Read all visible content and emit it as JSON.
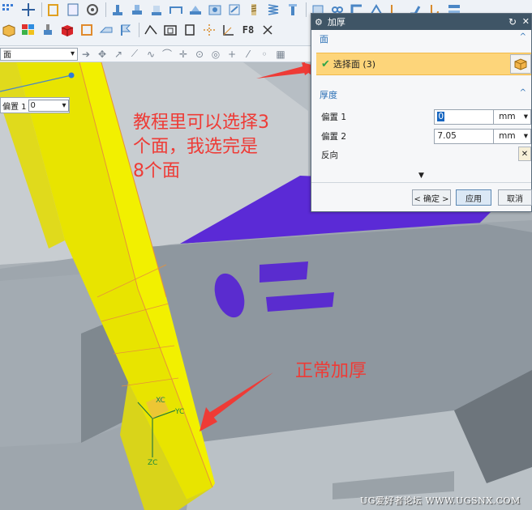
{
  "selection_bar": {
    "filter_text": "面"
  },
  "offset_popup": {
    "label": "偏置 1",
    "value": "0"
  },
  "dialog": {
    "title": "加厚",
    "face_section": {
      "header": "面",
      "select_label": "选择面 (3)"
    },
    "thickness_section": {
      "header": "厚度",
      "offset1_label": "偏置 1",
      "offset1_value": "0",
      "offset2_label": "偏置 2",
      "offset2_value": "7.05",
      "unit": "mm",
      "reverse_label": "反向"
    },
    "buttons": {
      "ok": "< 确定 >",
      "apply": "应用",
      "cancel": "取消"
    }
  },
  "annotations": {
    "line1": "教程里可以选择3",
    "line2": "个面，我选完是",
    "line3": "8个面",
    "normal": "正常加厚"
  },
  "axes": {
    "xc": "XC",
    "yc": "YC",
    "zc": "ZC"
  },
  "toolbar": {
    "f8_label": "F8"
  },
  "watermark": "UG爱好者论坛 WWW.UGSNX.COM",
  "colors": {
    "yellow_body": "#f2f000",
    "purple_face": "#5b2ad6",
    "highlight_row": "#fdd57a",
    "annotation": "#ee3b36"
  }
}
